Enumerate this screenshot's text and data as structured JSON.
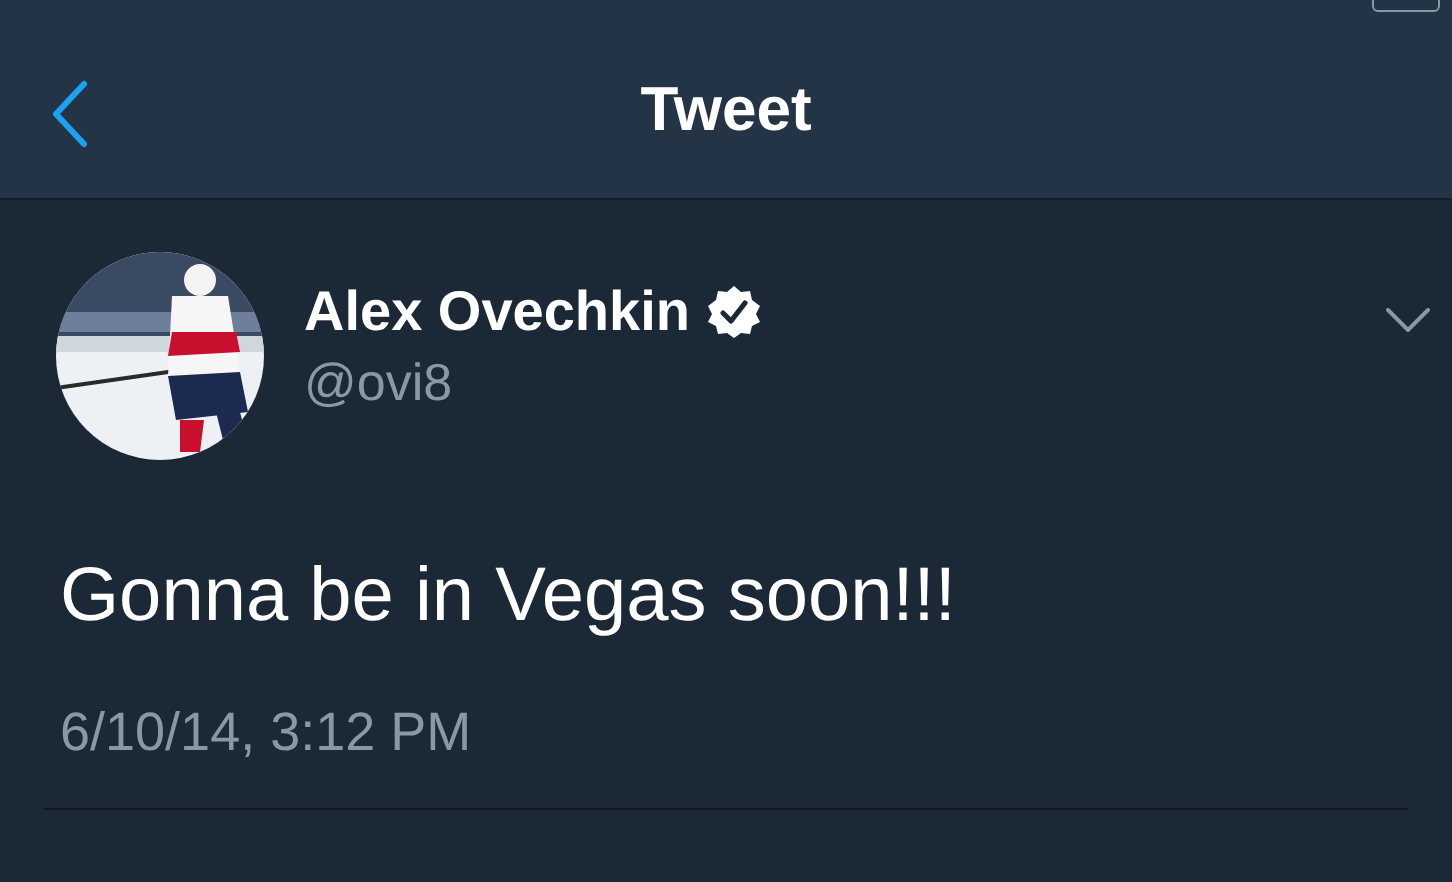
{
  "nav_bar": {
    "title": "Tweet"
  },
  "tweet": {
    "author": {
      "name": "Alex Ovechkin",
      "verified": true,
      "handle": "@ovi8"
    },
    "text": "Gonna be in Vegas soon!!!",
    "timestamp": "6/10/14, 3:12 PM"
  }
}
